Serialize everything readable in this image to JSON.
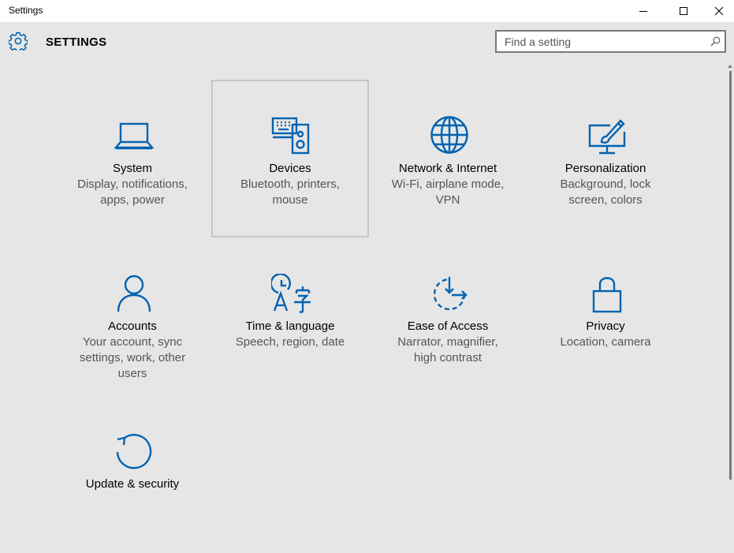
{
  "window": {
    "title": "Settings"
  },
  "header": {
    "page_title": "SETTINGS",
    "icon": "gear-icon"
  },
  "search": {
    "placeholder": "Find a setting",
    "value": "",
    "icon": "search-icon"
  },
  "colors": {
    "accent": "#0063b1",
    "background": "#e6e6e6",
    "secondary_text": "#555555"
  },
  "categories": [
    {
      "name": "System",
      "desc_lines": [
        "Display, notifications,",
        "apps, power"
      ],
      "icon": "laptop-icon"
    },
    {
      "name": "Devices",
      "desc_lines": [
        "Bluetooth, printers,",
        "mouse"
      ],
      "icon": "devices-icon",
      "selected": true
    },
    {
      "name": "Network & Internet",
      "desc_lines": [
        "Wi-Fi, airplane mode,",
        "VPN"
      ],
      "icon": "globe-icon"
    },
    {
      "name": "Personalization",
      "desc_lines": [
        "Background, lock",
        "screen, colors"
      ],
      "icon": "personalization-icon"
    },
    {
      "name": "Accounts",
      "desc_lines": [
        "Your account, sync",
        "settings, work, other",
        "users"
      ],
      "icon": "person-icon"
    },
    {
      "name": "Time & language",
      "desc_lines": [
        "Speech, region, date"
      ],
      "icon": "time-language-icon"
    },
    {
      "name": "Ease of Access",
      "desc_lines": [
        "Narrator, magnifier,",
        "high contrast"
      ],
      "icon": "ease-of-access-icon"
    },
    {
      "name": "Privacy",
      "desc_lines": [
        "Location, camera"
      ],
      "icon": "lock-icon"
    },
    {
      "name": "Update & security",
      "desc_lines": [],
      "icon": "refresh-icon"
    }
  ]
}
